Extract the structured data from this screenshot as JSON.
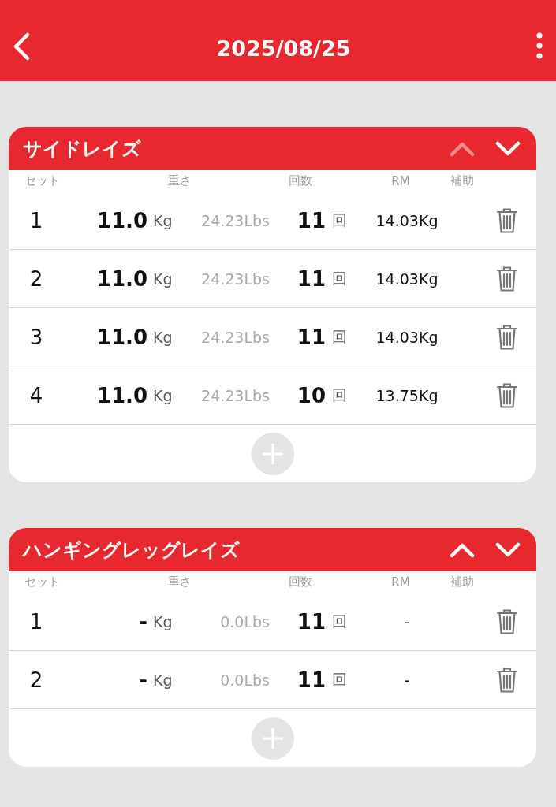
{
  "header": {
    "title": "2025/08/25"
  },
  "exercises": [
    {
      "name": "サイドレイズ",
      "move_up_disabled": true,
      "move_down_disabled": false,
      "columns": [
        "セット",
        "重さ",
        "回数",
        "RM",
        "補助"
      ],
      "sets": [
        {
          "set": "1",
          "weight": "11.0",
          "weight_unit": "Kg",
          "lbs": "24.23Lbs",
          "reps": "11",
          "reps_unit": "回",
          "rm": "14.03Kg"
        },
        {
          "set": "2",
          "weight": "11.0",
          "weight_unit": "Kg",
          "lbs": "24.23Lbs",
          "reps": "11",
          "reps_unit": "回",
          "rm": "14.03Kg"
        },
        {
          "set": "3",
          "weight": "11.0",
          "weight_unit": "Kg",
          "lbs": "24.23Lbs",
          "reps": "11",
          "reps_unit": "回",
          "rm": "14.03Kg"
        },
        {
          "set": "4",
          "weight": "11.0",
          "weight_unit": "Kg",
          "lbs": "24.23Lbs",
          "reps": "10",
          "reps_unit": "回",
          "rm": "13.75Kg"
        }
      ]
    },
    {
      "name": "ハンギングレッグレイズ",
      "move_up_disabled": false,
      "move_down_disabled": false,
      "columns": [
        "セット",
        "重さ",
        "回数",
        "RM",
        "補助"
      ],
      "sets": [
        {
          "set": "1",
          "weight": "-",
          "weight_unit": "Kg",
          "lbs": "0.0Lbs",
          "reps": "11",
          "reps_unit": "回",
          "rm": "-"
        },
        {
          "set": "2",
          "weight": "-",
          "weight_unit": "Kg",
          "lbs": "0.0Lbs",
          "reps": "11",
          "reps_unit": "回",
          "rm": "-"
        }
      ]
    }
  ]
}
